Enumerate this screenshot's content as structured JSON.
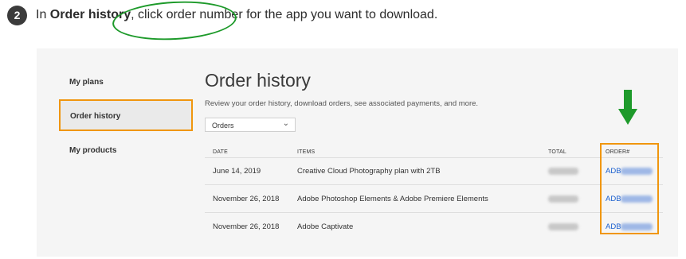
{
  "step": {
    "number": "2"
  },
  "instruction": {
    "prefix": "In ",
    "bold": "Order history",
    "suffix": ", click order number for the app you want to download."
  },
  "sidebar": {
    "items": [
      {
        "label": "My plans"
      },
      {
        "label": "Order history",
        "active": true
      },
      {
        "label": "My products"
      }
    ]
  },
  "main": {
    "title": "Order history",
    "description": "Review your order history, download orders, see associated payments, and more.",
    "filter": {
      "selected": "Orders"
    },
    "table": {
      "columns": [
        "DATE",
        "ITEMS",
        "TOTAL",
        "ORDER#"
      ],
      "rows": [
        {
          "date": "June 14, 2019",
          "item": "Creative Cloud Photography plan with 2TB",
          "order_prefix": "ADB"
        },
        {
          "date": "November 26, 2018",
          "item": "Adobe Photoshop Elements & Adobe Premiere Elements",
          "order_prefix": "ADB"
        },
        {
          "date": "November 26, 2018",
          "item": "Adobe Captivate",
          "order_prefix": "ADB"
        }
      ]
    }
  },
  "colors": {
    "annotation_green": "#1e9a2b",
    "highlight_orange": "#f0960e",
    "link_blue": "#1a5fcf"
  }
}
